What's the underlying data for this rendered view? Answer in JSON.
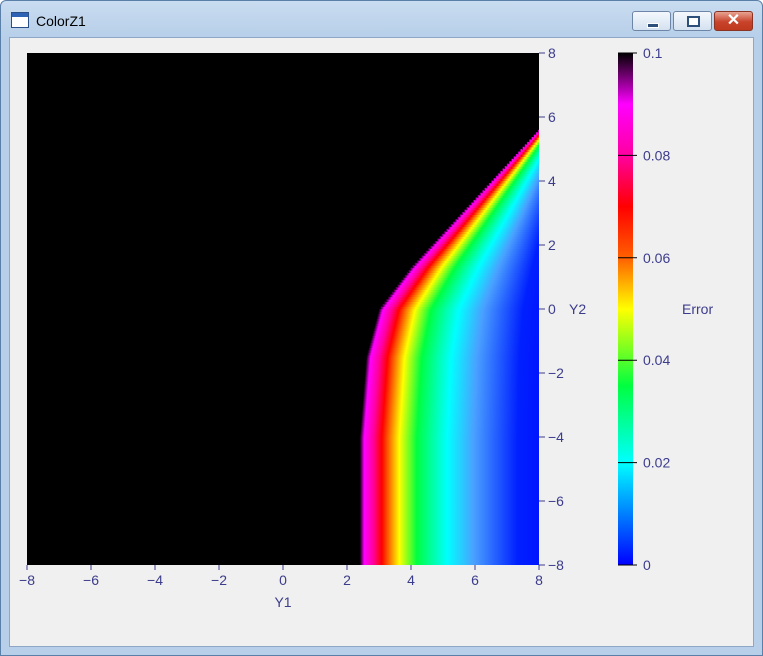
{
  "window": {
    "title": "ColorZ1",
    "buttons": {
      "minimize": "minimize-icon",
      "maximize": "maximize-icon",
      "close": "close-icon"
    }
  },
  "colors": {
    "axis_text": "#3c3c8c",
    "client_bg": "#f0f0f0",
    "background_region": "#000000"
  },
  "chart_data": {
    "type": "heatmap",
    "x": {
      "label": "Y1",
      "range": [
        -8,
        8
      ],
      "ticks": [
        -8,
        -6,
        -4,
        -2,
        0,
        2,
        4,
        6,
        8
      ],
      "tick_labels": [
        "−8",
        "−6",
        "−4",
        "−2",
        "0",
        "2",
        "4",
        "6",
        "8"
      ]
    },
    "y": {
      "label": "Y2",
      "range": [
        -8,
        8
      ],
      "ticks": [
        8,
        6,
        4,
        2,
        0,
        -2,
        -4,
        -6,
        -8
      ],
      "tick_labels": [
        "8",
        "6",
        "4",
        "2",
        "0",
        "−2",
        "−4",
        "−6",
        "−8"
      ],
      "axis_side": "right"
    },
    "colorbar": {
      "label": "Error",
      "range": [
        0,
        0.1
      ],
      "ticks": [
        0.1,
        0.08,
        0.06,
        0.04,
        0.02,
        0
      ],
      "tick_labels": [
        "0.1",
        "0.08",
        "0.06",
        "0.04",
        "0.02",
        "0"
      ],
      "colormap": [
        [
          0.0,
          "#0000ff"
        ],
        [
          0.2,
          "#00ffff"
        ],
        [
          0.35,
          "#00ff40"
        ],
        [
          0.5,
          "#ffff00"
        ],
        [
          0.6,
          "#ff6000"
        ],
        [
          0.7,
          "#ff0000"
        ],
        [
          0.8,
          "#ff00a0"
        ],
        [
          0.9,
          "#ff00ff"
        ],
        [
          1.0,
          "#000000"
        ]
      ]
    },
    "regions": {
      "zero_error_boundary": {
        "description_points": [
          [
            2.4,
            -8
          ],
          [
            2.4,
            -4
          ],
          [
            2.6,
            -1.5
          ],
          [
            3.0,
            0
          ],
          [
            4.0,
            1.3
          ],
          [
            8.0,
            5.6
          ]
        ]
      }
    }
  }
}
